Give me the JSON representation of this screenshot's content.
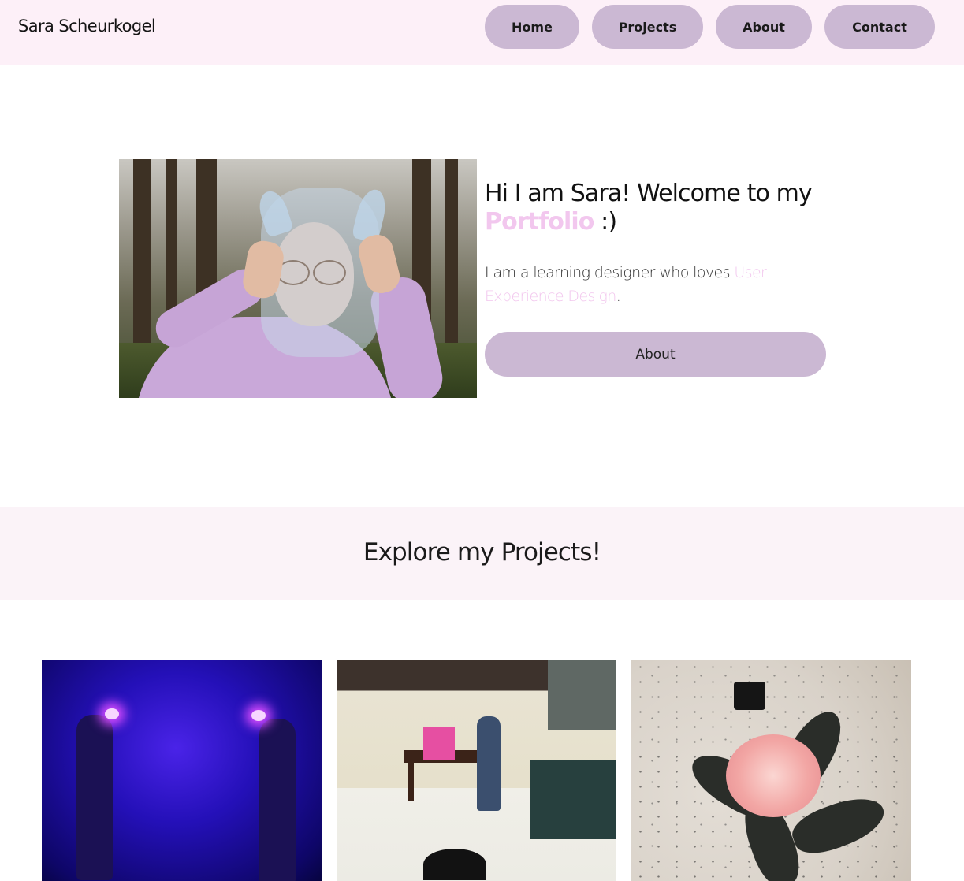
{
  "nav": {
    "brand": "Sara Scheurkogel",
    "links": [
      "Home",
      "Projects",
      "About",
      "Contact"
    ]
  },
  "hero": {
    "title_prefix": "Hi I am Sara! Welcome to my",
    "title_accent": "Portfolio",
    "title_suffix": " :)",
    "text_prefix": "I am a learning designer who loves ",
    "text_accent": "User Experience Design",
    "text_suffix": ".",
    "button": "About",
    "image": "portrait-photo"
  },
  "projects": {
    "heading": "Explore my Projects!",
    "cards": [
      {
        "image": "neon-headpiece-performance-photo"
      },
      {
        "image": "3d-kitchen-scene-render"
      },
      {
        "image": "lotus-flower-object-photo"
      }
    ]
  },
  "colors": {
    "nav_bg": "#fdf0f8",
    "button_bg": "#cbb8d3",
    "accent": "#f2c7ee",
    "band_bg": "#fbf3f8"
  }
}
